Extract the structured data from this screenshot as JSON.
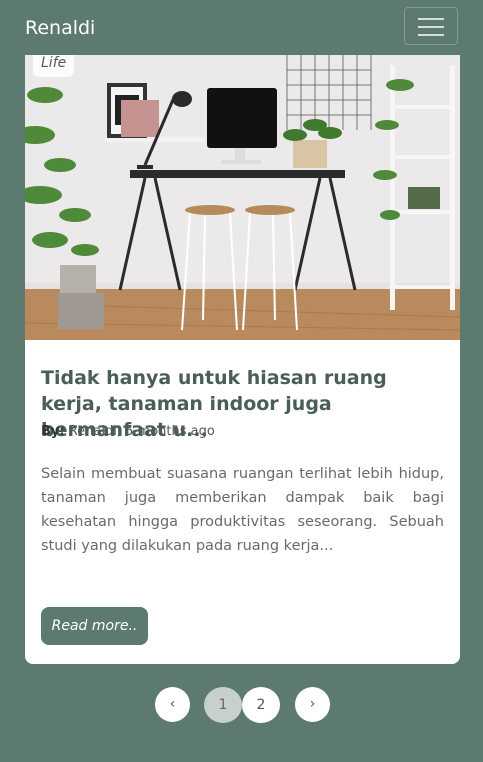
{
  "navbar": {
    "brand": "Renaldi"
  },
  "post": {
    "category": "Life",
    "title": "Tidak hanya untuk hiasan ruang kerja, tanaman indoor juga bermanfaat u...",
    "meta_label": "By:",
    "meta_value": "Renaldi, 5 months ago",
    "excerpt": "Selain membuat suasana ruangan terlihat lebih hidup, tanaman juga memberikan dampak baik bagi kesehatan hingga produktivitas seseorang. Sebuah studi yang dilakukan pada ruang kerja...",
    "read_more": "Read more.."
  },
  "pagination": {
    "prev": "‹",
    "pages": [
      "1",
      "2"
    ],
    "next": "›",
    "active_page": "1"
  },
  "colors": {
    "brand": "#5c7a6f",
    "card": "#ffffff"
  }
}
